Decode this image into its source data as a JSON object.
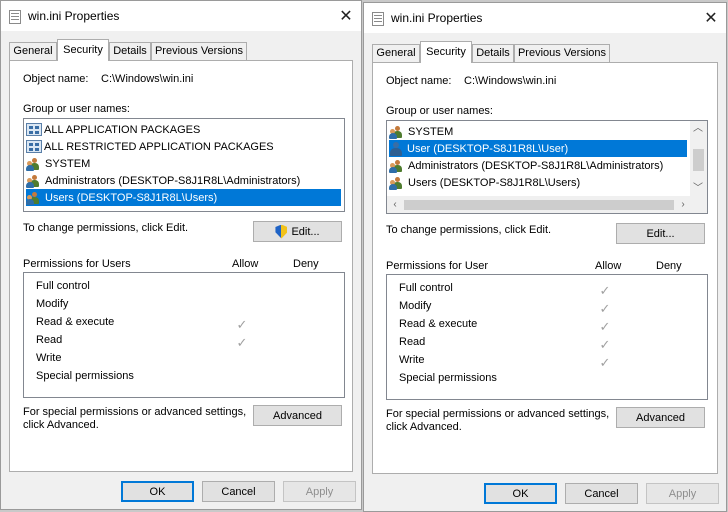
{
  "left_window": {
    "title": "win.ini Properties",
    "tabs": [
      "General",
      "Security",
      "Details",
      "Previous Versions"
    ],
    "object_name_label": "Object name:",
    "object_name_value": "C:\\Windows\\win.ini",
    "group_label": "Group or user names:",
    "groups": [
      "ALL APPLICATION PACKAGES",
      "ALL RESTRICTED APPLICATION PACKAGES",
      "SYSTEM",
      "Administrators (DESKTOP-S8J1R8L\\Administrators)",
      "Users (DESKTOP-S8J1R8L\\Users)"
    ],
    "selected_index": 4,
    "change_text": "To change permissions, click Edit.",
    "edit_label": "Edit...",
    "perm_for": "Permissions for Users",
    "allow_label": "Allow",
    "deny_label": "Deny",
    "permissions": [
      "Full control",
      "Modify",
      "Read & execute",
      "Read",
      "Write",
      "Special permissions"
    ],
    "allow_checked": [
      false,
      false,
      true,
      true,
      false,
      false
    ],
    "special_text_1": "For special permissions or advanced settings,",
    "special_text_2": "click Advanced.",
    "advanced_label": "Advanced",
    "ok_label": "OK",
    "cancel_label": "Cancel",
    "apply_label": "Apply"
  },
  "right_window": {
    "title": "win.ini Properties",
    "tabs": [
      "General",
      "Security",
      "Details",
      "Previous Versions"
    ],
    "object_name_label": "Object name:",
    "object_name_value": "C:\\Windows\\win.ini",
    "group_label": "Group or user names:",
    "groups": [
      "SYSTEM",
      "User (DESKTOP-S8J1R8L\\User)",
      "Administrators (DESKTOP-S8J1R8L\\Administrators)",
      "Users (DESKTOP-S8J1R8L\\Users)"
    ],
    "selected_index": 1,
    "change_text": "To change permissions, click Edit.",
    "edit_label": "Edit...",
    "perm_for": "Permissions for User",
    "allow_label": "Allow",
    "deny_label": "Deny",
    "permissions": [
      "Full control",
      "Modify",
      "Read & execute",
      "Read",
      "Write",
      "Special permissions"
    ],
    "allow_checked": [
      true,
      true,
      true,
      true,
      true,
      false
    ],
    "special_text_1": "For special permissions or advanced settings,",
    "special_text_2": "click Advanced.",
    "advanced_label": "Advanced",
    "ok_label": "OK",
    "cancel_label": "Cancel",
    "apply_label": "Apply"
  },
  "icons": {
    "close": "close-icon",
    "check": "check-icon",
    "shield": "uac-shield-icon",
    "file": "file-icon"
  },
  "colors": {
    "selection": "#0078d7",
    "default_button_border": "#0078d7",
    "check": "#a0a0a0"
  }
}
